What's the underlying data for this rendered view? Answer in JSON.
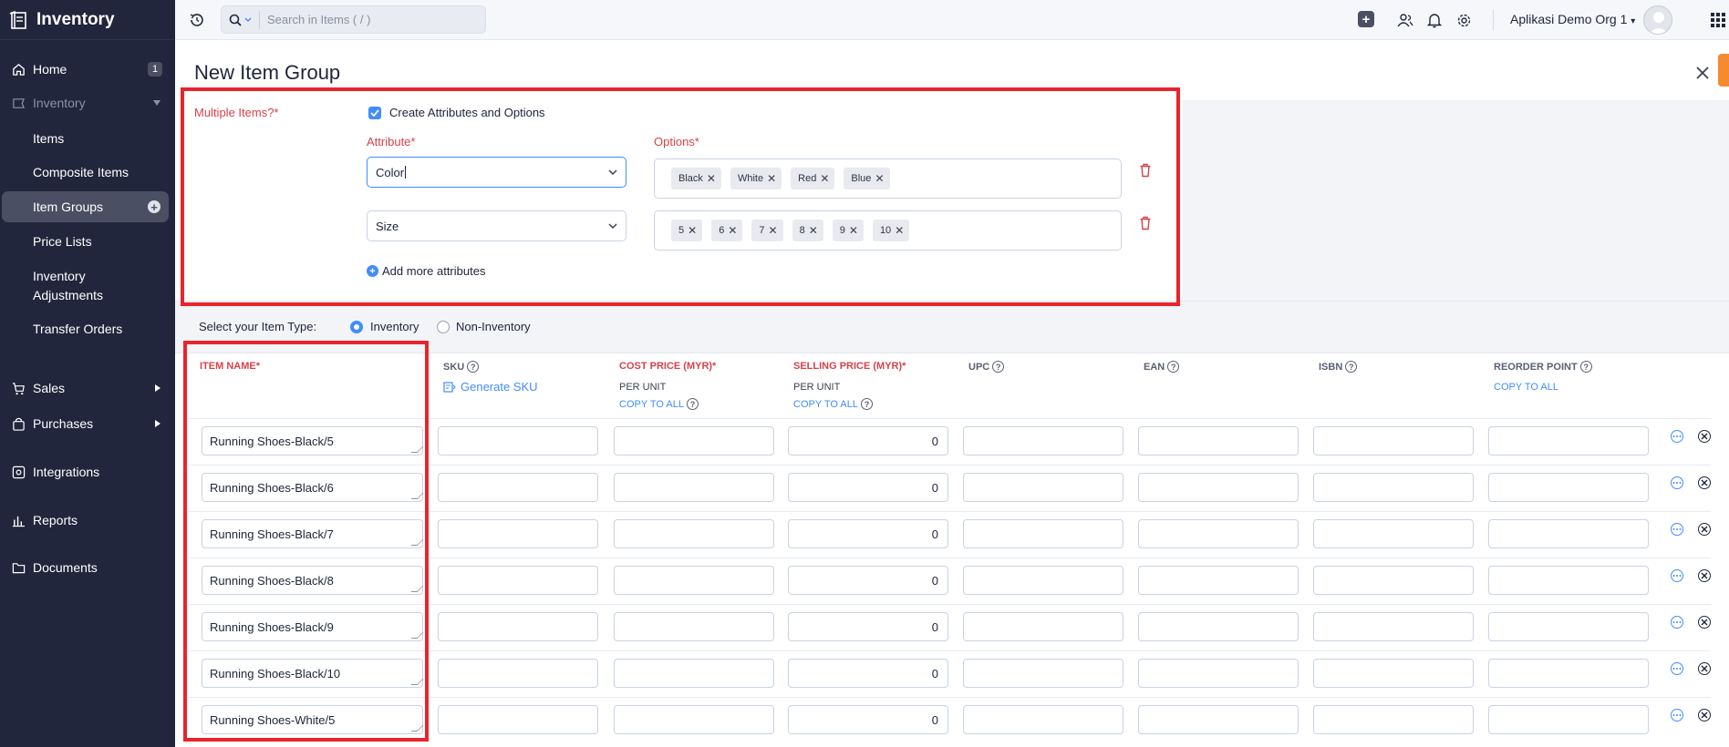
{
  "app": {
    "title": "Inventory"
  },
  "sidebar": {
    "home": {
      "label": "Home",
      "badge": "1"
    },
    "inventory": {
      "label": "Inventory"
    },
    "sub_items": [
      "Items",
      "Composite Items",
      "Item Groups",
      "Price Lists",
      "Inventory",
      "Adjustments",
      "Transfer Orders"
    ],
    "sales": "Sales",
    "purchases": "Purchases",
    "integrations": "Integrations",
    "reports": "Reports",
    "documents": "Documents"
  },
  "topbar": {
    "search_placeholder": "Search in Items ( / )",
    "org_name": "Aplikasi Demo Org 1"
  },
  "page": {
    "title": "New Item Group"
  },
  "form": {
    "multiple_items_label": "Multiple Items?*",
    "create_attr_label": "Create Attributes and Options",
    "attribute_label": "Attribute*",
    "options_label": "Options*",
    "attributes": [
      {
        "value": "Color",
        "options": [
          "Black",
          "White",
          "Red",
          "Blue"
        ]
      },
      {
        "value": "Size",
        "options": [
          "5",
          "6",
          "7",
          "8",
          "9",
          "10"
        ]
      }
    ],
    "add_more": "Add more attributes",
    "item_type_label": "Select your Item Type:",
    "item_type_options": [
      "Inventory",
      "Non-Inventory"
    ],
    "item_type_selected": "Inventory"
  },
  "table": {
    "headers": {
      "item_name": "ITEM NAME*",
      "sku": "SKU",
      "cost_price": "COST PRICE (MYR)*",
      "selling_price": "SELLING PRICE (MYR)*",
      "upc": "UPC",
      "ean": "EAN",
      "isbn": "ISBN",
      "reorder_point": "REORDER POINT"
    },
    "generate_sku": "Generate SKU",
    "per_unit": "PER UNIT",
    "copy_to_all": "COPY TO ALL",
    "rows": [
      {
        "name": "Running Shoes-Black/5",
        "selling_price": "0"
      },
      {
        "name": "Running Shoes-Black/6",
        "selling_price": "0"
      },
      {
        "name": "Running Shoes-Black/7",
        "selling_price": "0"
      },
      {
        "name": "Running Shoes-Black/8",
        "selling_price": "0"
      },
      {
        "name": "Running Shoes-Black/9",
        "selling_price": "0"
      },
      {
        "name": "Running Shoes-Black/10",
        "selling_price": "0"
      },
      {
        "name": "Running Shoes-White/5",
        "selling_price": "0"
      }
    ]
  },
  "colors": {
    "accent": "#408dfb",
    "required": "#d6424b",
    "sidebar": "#21263c",
    "highlight": "#e8242d"
  }
}
